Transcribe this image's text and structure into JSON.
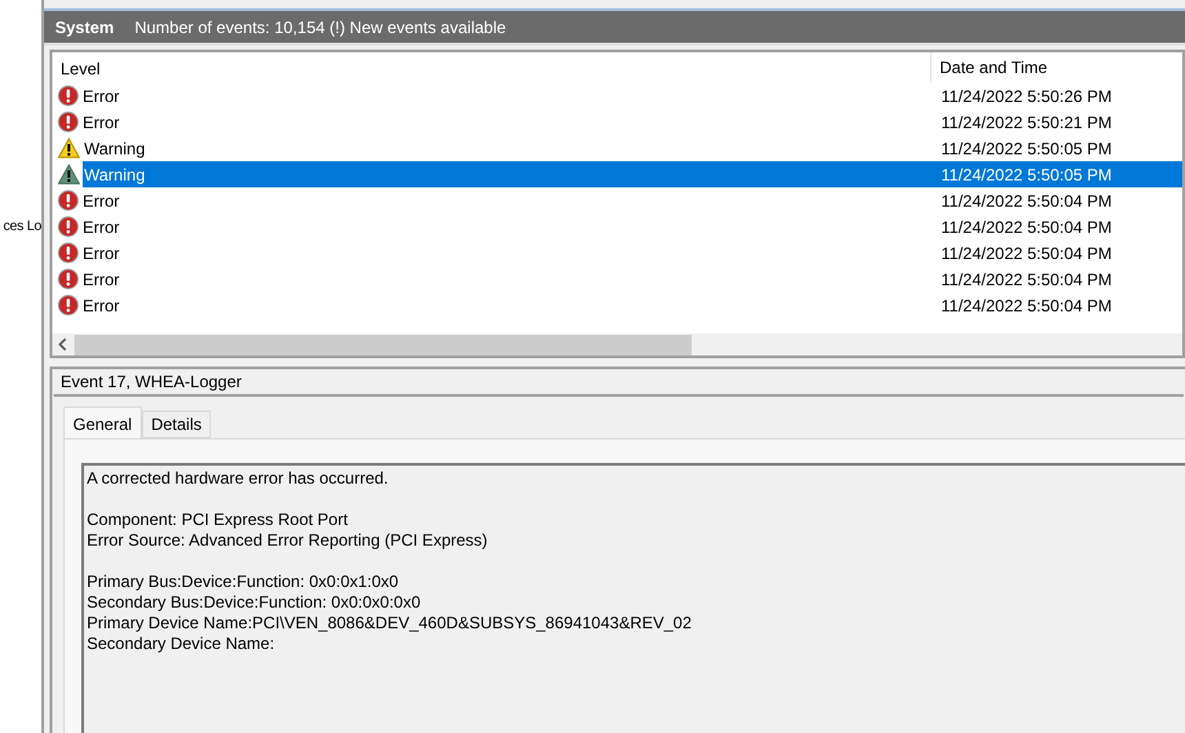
{
  "sidebar": {
    "items": [
      {
        "label": "ces Lo"
      }
    ]
  },
  "header": {
    "title": "System",
    "summary": "Number of events: 10,154 (!) New events available"
  },
  "table": {
    "columns": [
      "Level",
      "Date and Time"
    ],
    "rows": [
      {
        "kind": "error",
        "level": "Error",
        "date": "11/24/2022 5:50:26 PM",
        "selected": false
      },
      {
        "kind": "error",
        "level": "Error",
        "date": "11/24/2022 5:50:21 PM",
        "selected": false
      },
      {
        "kind": "warning",
        "level": "Warning",
        "date": "11/24/2022 5:50:05 PM",
        "selected": false
      },
      {
        "kind": "warning",
        "level": "Warning",
        "date": "11/24/2022 5:50:05 PM",
        "selected": true
      },
      {
        "kind": "error",
        "level": "Error",
        "date": "11/24/2022 5:50:04 PM",
        "selected": false
      },
      {
        "kind": "error",
        "level": "Error",
        "date": "11/24/2022 5:50:04 PM",
        "selected": false
      },
      {
        "kind": "error",
        "level": "Error",
        "date": "11/24/2022 5:50:04 PM",
        "selected": false
      },
      {
        "kind": "error",
        "level": "Error",
        "date": "11/24/2022 5:50:04 PM",
        "selected": false
      },
      {
        "kind": "error",
        "level": "Error",
        "date": "11/24/2022 5:50:04 PM",
        "selected": false
      }
    ]
  },
  "details": {
    "title": "Event 17, WHEA-Logger",
    "tabs": [
      {
        "label": "General",
        "selected": true
      },
      {
        "label": "Details",
        "selected": false
      }
    ],
    "message": [
      [
        "A corrected hardware error has occurred."
      ],
      [
        "Component: PCI Express Root Port",
        "Error Source: Advanced Error Reporting (PCI Express)"
      ],
      [
        "Primary Bus:Device:Function: 0x0:0x1:0x0",
        "Secondary Bus:Device:Function: 0x0:0x0:0x0",
        "Primary Device Name:PCI\\VEN_8086&DEV_460D&SUBSYS_86941043&REV_02",
        "Secondary Device Name:"
      ]
    ]
  }
}
